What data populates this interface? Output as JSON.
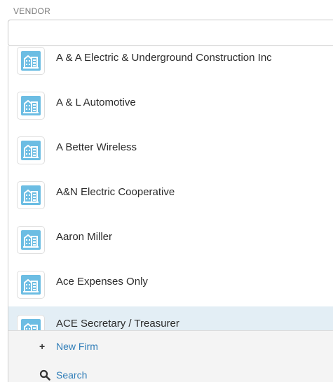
{
  "field": {
    "label": "VENDOR",
    "value": "",
    "placeholder": ""
  },
  "vendors": [
    {
      "label": "A & A Electric & Underground Construction Inc",
      "icon": "building-icon"
    },
    {
      "label": "A & L Automotive",
      "icon": "building-icon"
    },
    {
      "label": "A Better Wireless",
      "icon": "building-icon"
    },
    {
      "label": "A&N Electric Cooperative",
      "icon": "building-icon"
    },
    {
      "label": "Aaron Miller",
      "icon": "building-icon"
    },
    {
      "label": "Ace Expenses Only",
      "icon": "building-icon"
    },
    {
      "label": "ACE Secretary / Treasurer",
      "icon": "building-icon"
    }
  ],
  "highlighted_index": 6,
  "footer": {
    "new_firm": {
      "glyph": "+",
      "label": "New Firm"
    },
    "search": {
      "glyph": "search-icon",
      "label": "Search"
    }
  },
  "colors": {
    "icon": "#6cbde3",
    "link": "#2f7db8",
    "highlight": "#e3eef5"
  }
}
